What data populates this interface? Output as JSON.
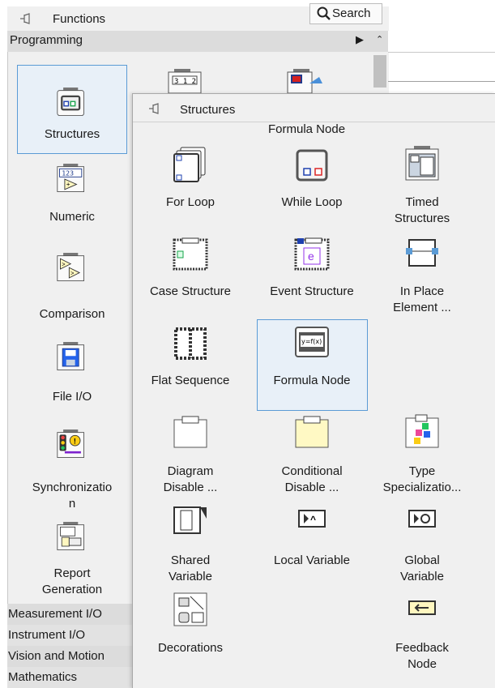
{
  "functions_palette": {
    "title": "Functions",
    "search_label": "Search",
    "category": "Programming",
    "items": [
      {
        "label": "Structures",
        "icon": "structures-icon"
      },
      {
        "label": "Numeric",
        "icon": "numeric-icon"
      },
      {
        "label": "Comparison",
        "icon": "comparison-icon"
      },
      {
        "label": "File I/O",
        "icon": "file-io-icon"
      },
      {
        "label": "Synchronizatio\nn",
        "icon": "synchronization-icon"
      },
      {
        "label": "Report\nGeneration",
        "icon": "report-generation-icon"
      }
    ],
    "categories": [
      "Measurement I/O",
      "Instrument I/O",
      "Vision and Motion",
      "Mathematics"
    ]
  },
  "structures_palette": {
    "title": "Structures",
    "top_label": "Formula Node",
    "items": [
      {
        "label": "For Loop",
        "icon": "for-loop-icon"
      },
      {
        "label": "While Loop",
        "icon": "while-loop-icon"
      },
      {
        "label": "Timed\nStructures",
        "icon": "timed-structures-icon"
      },
      {
        "label": "Case Structure",
        "icon": "case-structure-icon"
      },
      {
        "label": "Event Structure",
        "icon": "event-structure-icon"
      },
      {
        "label": "In Place\nElement ...",
        "icon": "in-place-element-icon"
      },
      {
        "label": "Flat Sequence",
        "icon": "flat-sequence-icon"
      },
      {
        "label": "Formula Node",
        "icon": "formula-node-icon"
      },
      {
        "label": "Diagram\nDisable ...",
        "icon": "diagram-disable-icon"
      },
      {
        "label": "Conditional\nDisable ...",
        "icon": "conditional-disable-icon"
      },
      {
        "label": "Type\nSpecializatio...",
        "icon": "type-specialization-icon"
      },
      {
        "label": "Shared\nVariable",
        "icon": "shared-variable-icon"
      },
      {
        "label": "Local Variable",
        "icon": "local-variable-icon"
      },
      {
        "label": "Global\nVariable",
        "icon": "global-variable-icon"
      },
      {
        "label": "Decorations",
        "icon": "decorations-icon"
      },
      {
        "label": "Feedback\nNode",
        "icon": "feedback-node-icon"
      }
    ]
  },
  "colors": {
    "selection_border": "#5b9bd5",
    "palette_bg": "#f0f0f0",
    "category_bg": "#dcdcdc"
  }
}
